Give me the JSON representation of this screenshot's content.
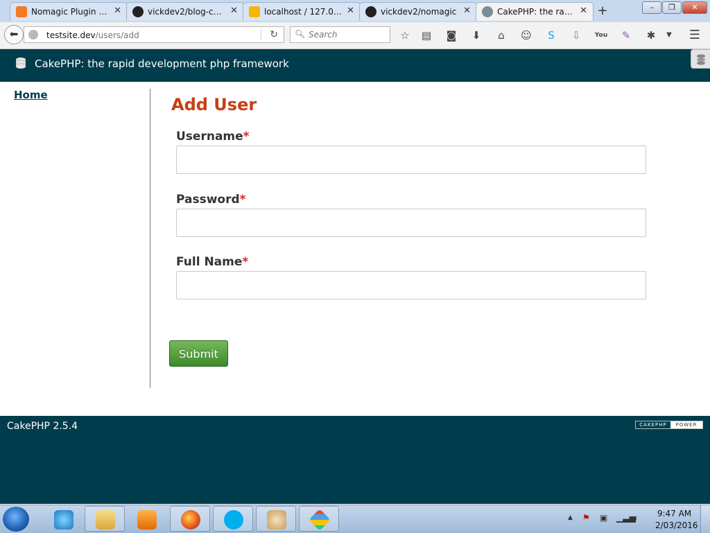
{
  "browser": {
    "tabs": [
      {
        "title": "Nomagic Plugin P...",
        "icon": "xampp-icon",
        "color": "#f37a1f"
      },
      {
        "title": "vickdev2/blog-cak...",
        "icon": "github-icon",
        "color": "#222222"
      },
      {
        "title": "localhost / 127.0.0....",
        "icon": "phpmyadmin-icon",
        "color": "#f8b500"
      },
      {
        "title": "vickdev2/nomagic",
        "icon": "github-icon",
        "color": "#222222"
      },
      {
        "title": "CakePHP: the rapi...",
        "icon": "cakephp-icon",
        "color": "#7a8d99"
      }
    ],
    "active_tab": 4,
    "new_tab_label": "+",
    "url_host": "testsite.dev",
    "url_path": "/users/add",
    "search_placeholder": "Search"
  },
  "page": {
    "header_title": "CakePHP: the rapid development php framework",
    "sidebar": {
      "home_label": "Home"
    },
    "form": {
      "title": "Add User",
      "fields": [
        {
          "label": "Username",
          "required_mark": "*",
          "value": ""
        },
        {
          "label": "Password",
          "required_mark": "*",
          "value": ""
        },
        {
          "label": "Full Name",
          "required_mark": "*",
          "value": ""
        }
      ],
      "submit_label": "Submit"
    },
    "footer": {
      "version": "CakePHP 2.5.4",
      "badge_left": "CAKEPHP",
      "badge_right": "POWER"
    }
  },
  "colors": {
    "brand_dark": "#003d4c",
    "title_red": "#c73e14",
    "required_red": "#dd2222",
    "submit_green": "#3d8a2b"
  },
  "taskbar": {
    "time": "9:47 AM",
    "date": "2/03/2016"
  }
}
